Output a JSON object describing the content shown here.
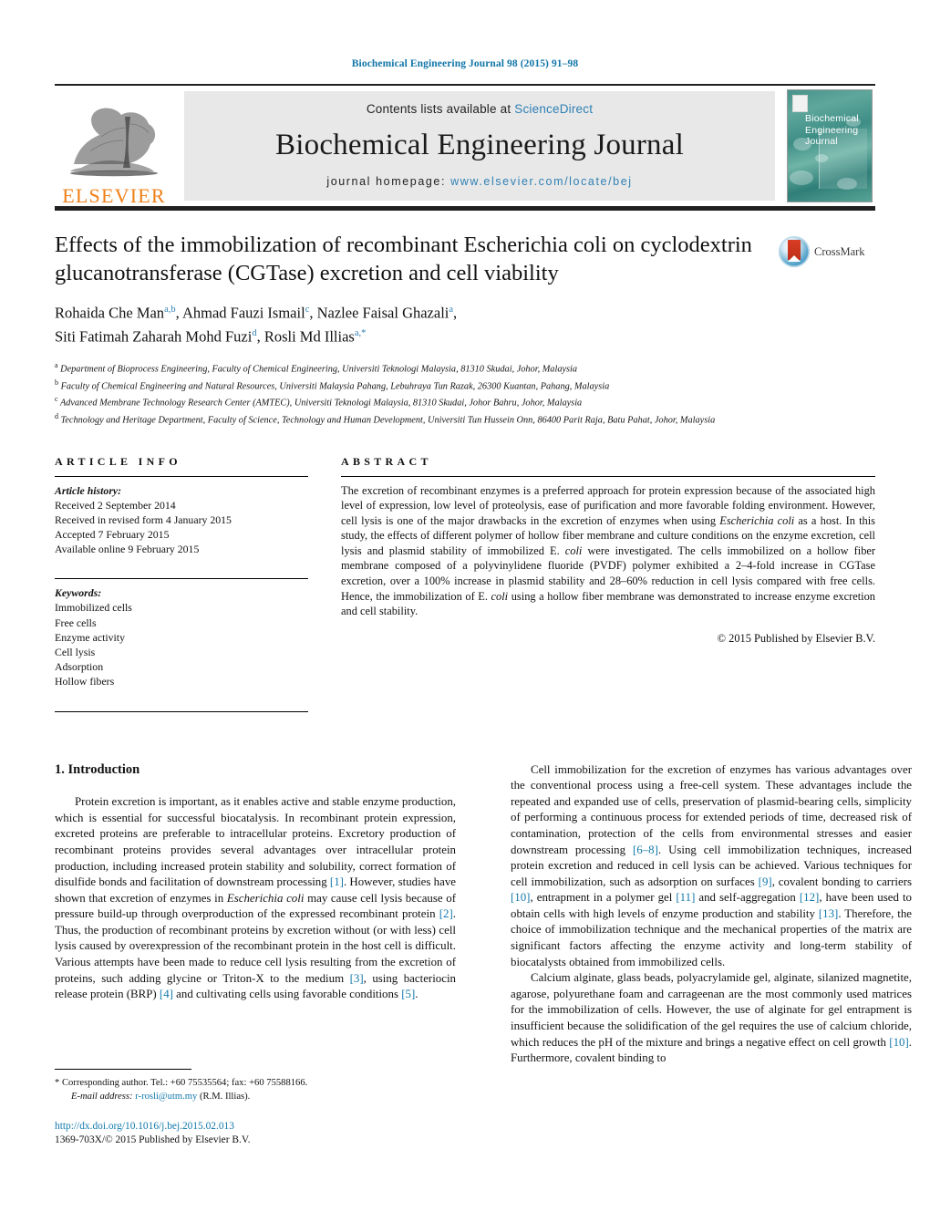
{
  "running_head": "Biochemical Engineering Journal 98 (2015) 91–98",
  "masthead": {
    "publisher_name": "ELSEVIER",
    "contents_prefix": "Contents lists available at ",
    "contents_link": "ScienceDirect",
    "journal_title": "Biochemical Engineering Journal",
    "homepage_prefix": "journal homepage: ",
    "homepage_url": "www.elsevier.com/locate/bej",
    "cover_title_lines": [
      "Biochemical",
      "Engineering",
      "Journal"
    ]
  },
  "article": {
    "title": "Effects of the immobilization of recombinant Escherichia coli on cyclodextrin glucanotransferase (CGTase) excretion and cell viability",
    "crossmark_label": "CrossMark",
    "authors_line1": "Rohaida Che Man",
    "authors_line1_sup": "a,b",
    "authors_line1_b": ", Ahmad Fauzi Ismail",
    "authors_line1_b_sup": "c",
    "authors_line1_c": ", Nazlee Faisal Ghazali",
    "authors_line1_c_sup": "a",
    "authors_line1_d": ",",
    "authors_line2": "Siti Fatimah Zaharah Mohd Fuzi",
    "authors_line2_sup": "d",
    "authors_line2_b": ", Rosli Md Illias",
    "authors_line2_b_sup": "a,*",
    "affiliations": [
      {
        "marker": "a",
        "text": "Department of Bioprocess Engineering, Faculty of Chemical Engineering, Universiti Teknologi Malaysia, 81310 Skudai, Johor, Malaysia"
      },
      {
        "marker": "b",
        "text": "Faculty of Chemical Engineering and Natural Resources, Universiti Malaysia Pahang, Lebuhraya Tun Razak, 26300 Kuantan, Pahang, Malaysia"
      },
      {
        "marker": "c",
        "text": "Advanced Membrane Technology Research Center (AMTEC), Universiti Teknologi Malaysia, 81310 Skudai, Johor Bahru, Johor, Malaysia"
      },
      {
        "marker": "d",
        "text": "Technology and Heritage Department, Faculty of Science, Technology and Human Development, Universiti Tun Hussein Onn, 86400 Parit Raja, Batu Pahat, Johor, Malaysia"
      }
    ]
  },
  "article_info": {
    "heading": "ARTICLE INFO",
    "history_label": "Article history:",
    "history": [
      "Received 2 September 2014",
      "Received in revised form 4 January 2015",
      "Accepted 7 February 2015",
      "Available online 9 February 2015"
    ],
    "keywords_label": "Keywords:",
    "keywords": [
      "Immobilized cells",
      "Free cells",
      "Enzyme activity",
      "Cell lysis",
      "Adsorption",
      "Hollow fibers"
    ]
  },
  "abstract": {
    "heading": "ABSTRACT",
    "part1": "The excretion of recombinant enzymes is a preferred approach for protein expression because of the associated high level of expression, low level of proteolysis, ease of purification and more favorable folding environment. However, cell lysis is one of the major drawbacks in the excretion of enzymes when using ",
    "italic1": "Escherichia coli",
    "part2": " as a host. In this study, the effects of different polymer of hollow fiber membrane and culture conditions on the enzyme excretion, cell lysis and plasmid stability of immobilized E. ",
    "italic2": "coli",
    "part3": " were investigated. The cells immobilized on a hollow fiber membrane composed of a polyvinylidene fluoride (PVDF) polymer exhibited a 2–4-fold increase in CGTase excretion, over a 100% increase in plasmid stability and 28–60% reduction in cell lysis compared with free cells. Hence, the immobilization of E. ",
    "italic3": "coli",
    "part4": " using a hollow fiber membrane was demonstrated to increase enzyme excretion and cell stability.",
    "copyright": "© 2015 Published by Elsevier B.V."
  },
  "intro": {
    "section_title": "1.  Introduction",
    "left_p1_a": "Protein excretion is important, as it enables active and stable enzyme production, which is essential for successful biocatalysis. In recombinant protein expression, excreted proteins are preferable to intracellular proteins. Excretory production of recombinant proteins provides several advantages over intracellular protein production, including increased protein stability and solubility, correct formation of disulfide bonds and facilitation of downstream processing ",
    "ref1": "[1]",
    "left_p1_b": ". However, studies have shown that excretion of enzymes in ",
    "italic_ecoli": "Escherichia coli",
    "left_p1_c": " may cause cell lysis because of pressure build-up through overproduction of the expressed recombinant protein ",
    "ref2": "[2]",
    "left_p1_d": ". Thus, the production of recombinant proteins by excretion without (or with less) cell lysis caused by overexpression of the recombinant protein in the host cell is difficult. Various attempts have been made to reduce cell lysis resulting from the excretion of proteins, such adding glycine or Triton-X to the medium ",
    "ref3": "[3]",
    "left_p1_e": ", using bacteriocin release protein (BRP) ",
    "ref4": "[4]",
    "left_p1_f": " and cultivating cells using favorable conditions ",
    "ref5": "[5]",
    "left_p1_g": ".",
    "right_p1_a": "Cell immobilization for the excretion of enzymes has various advantages over the conventional process using a free-cell system. These advantages include the repeated and expanded use of cells, preservation of plasmid-bearing cells, simplicity of performing a continuous process for extended periods of time, decreased risk of contamination, protection of the cells from environmental stresses and easier downstream processing ",
    "ref68": "[6–8]",
    "right_p1_b": ". Using cell immobilization techniques, increased protein excretion and reduced in cell lysis can be achieved. Various techniques for cell immobilization, such as adsorption on surfaces ",
    "ref9": "[9]",
    "right_p1_c": ", covalent bonding to carriers ",
    "ref10": "[10]",
    "right_p1_d": ", entrapment in a polymer gel ",
    "ref11": "[11]",
    "right_p1_e": " and self-aggregation ",
    "ref12": "[12]",
    "right_p1_f": ", have been used to obtain cells with high levels of enzyme production and stability ",
    "ref13": "[13]",
    "right_p1_g": ". Therefore, the choice of immobilization technique and the mechanical properties of the matrix are significant factors affecting the enzyme activity and long-term stability of biocatalysts obtained from immobilized cells.",
    "right_p2_a": "Calcium alginate, glass beads, polyacrylamide gel, alginate, silanized magnetite, agarose, polyurethane foam and carrageenan are the most commonly used matrices for the immobilization of cells. However, the use of alginate for gel entrapment is insufficient because the solidification of the gel requires the use of calcium chloride, which reduces the pH of the mixture and brings a negative effect on cell growth ",
    "ref10b": "[10]",
    "right_p2_b": ". Furthermore, covalent binding to"
  },
  "footnote": {
    "corresponding": "* Corresponding author. Tel.: +60 75535564; fax: +60 75588166.",
    "email_label": "E-mail address:",
    "email": "r-rosli@utm.my",
    "email_suffix": "(R.M. Illias).",
    "doi": "http://dx.doi.org/10.1016/j.bej.2015.02.013",
    "issn": "1369-703X/© 2015 Published by Elsevier B.V."
  },
  "colors": {
    "link": "#1279ac",
    "elsevier_orange": "#f07f16",
    "band_gray": "#e8e8e8",
    "rule_black": "#221f1f"
  }
}
